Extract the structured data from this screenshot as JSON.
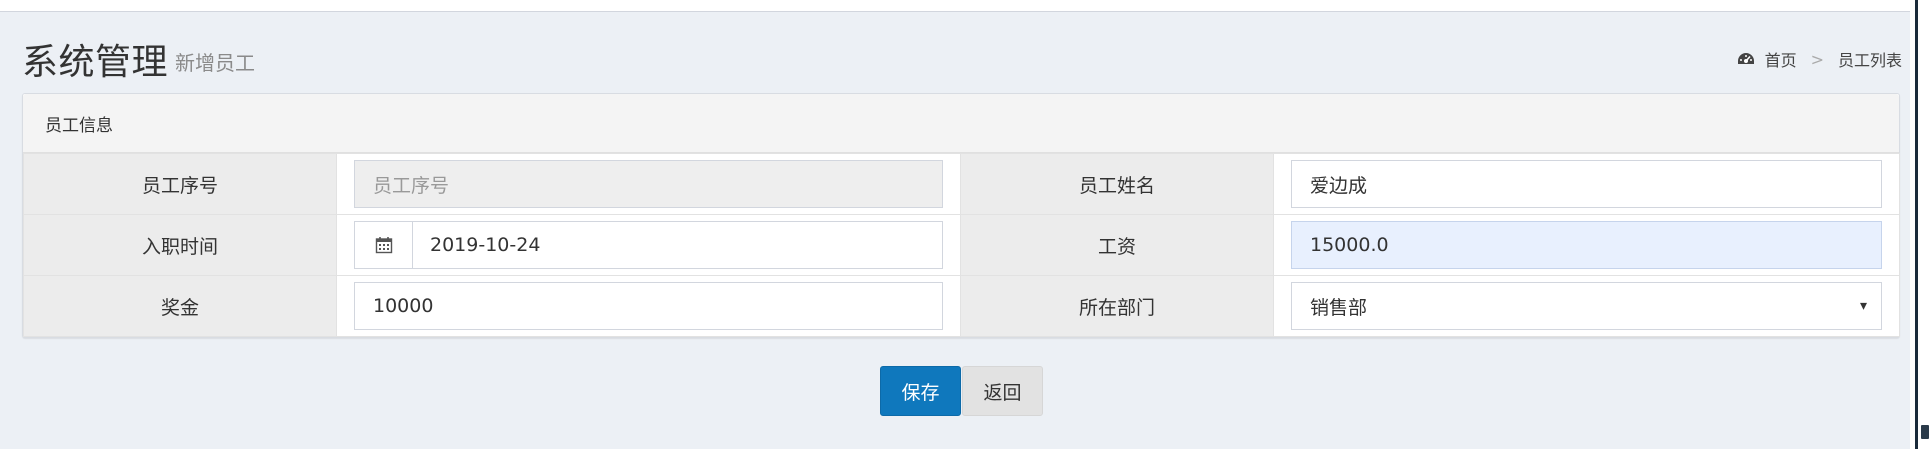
{
  "header": {
    "title": "系统管理",
    "subtitle": "新增员工"
  },
  "breadcrumb": {
    "icon": "dashboard-icon",
    "home": "首页",
    "separator": ">",
    "current": "员工列表"
  },
  "box": {
    "title": "员工信息"
  },
  "form": {
    "employee_no": {
      "label": "员工序号",
      "placeholder": "员工序号"
    },
    "employee_name": {
      "label": "员工姓名",
      "value": "爱边成"
    },
    "hire_date": {
      "label": "入职时间",
      "value": "2019-10-24",
      "icon": "calendar-icon"
    },
    "salary": {
      "label": "工资",
      "value": "15000.0"
    },
    "bonus": {
      "label": "奖金",
      "value": "10000"
    },
    "department": {
      "label": "所在部门",
      "value": "销售部"
    }
  },
  "actions": {
    "save_label": "保存",
    "back_label": "返回"
  },
  "colors": {
    "primary": "#0f78bd",
    "background": "#ecf0f5",
    "label_cell": "#ececec",
    "autofill": "#e8f0fe"
  }
}
